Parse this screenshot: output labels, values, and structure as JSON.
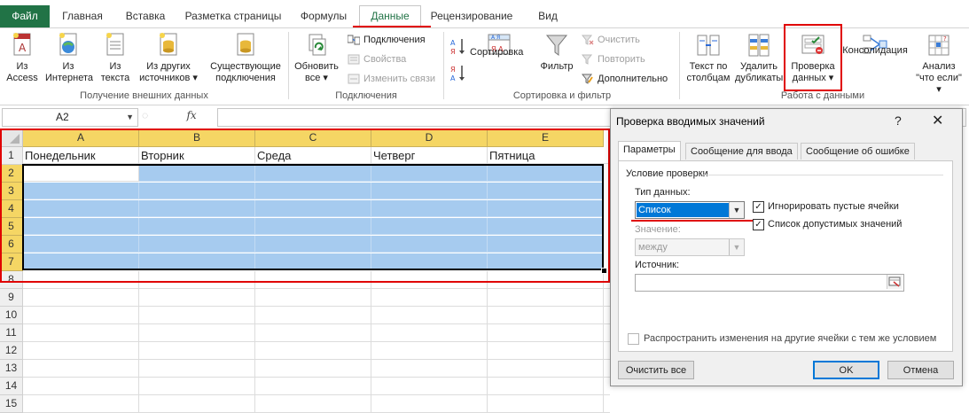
{
  "tabs": {
    "file": "Файл",
    "items": [
      "Главная",
      "Вставка",
      "Разметка страницы",
      "Формулы",
      "Данные",
      "Рецензирование",
      "Вид"
    ],
    "active": "Данные"
  },
  "ribbon": {
    "external": {
      "access": "Из Access",
      "web": "Из Интернета",
      "text": "Из текста",
      "other": "Из других источников ▾",
      "existing": "Существующие подключения",
      "label": "Получение внешних данных"
    },
    "connections": {
      "refresh": "Обновить все ▾",
      "connections": "Подключения",
      "properties": "Свойства",
      "edit_links": "Изменить связи",
      "label": "Подключения"
    },
    "sort_filter": {
      "sort": "Сортировка",
      "filter": "Фильтр",
      "clear": "Очистить",
      "reapply": "Повторить",
      "advanced": "Дополнительно",
      "label": "Сортировка и фильтр"
    },
    "data_tools": {
      "text_to_columns": "Текст по столбцам",
      "remove_duplicates": "Удалить дубликаты",
      "validation": "Проверка данных ▾",
      "consolidate": "Консолидация",
      "what_if": "Анализ \"что если\" ▾",
      "label": "Работа с данными"
    }
  },
  "formula_bar": {
    "name_box": "A2",
    "fx": "fx",
    "formula": ""
  },
  "sheet": {
    "columns": [
      "A",
      "B",
      "C",
      "D",
      "E"
    ],
    "rows": [
      "1",
      "2",
      "3",
      "4",
      "5",
      "6",
      "7",
      "8",
      "9",
      "10",
      "11",
      "12",
      "13",
      "14",
      "15"
    ],
    "row1": [
      "Понедельник",
      "Вторник",
      "Среда",
      "Четверг",
      "Пятница"
    ]
  },
  "dialog": {
    "title": "Проверка вводимых значений",
    "help": "?",
    "close": "✕",
    "tabs": [
      "Параметры",
      "Сообщение для ввода",
      "Сообщение об ошибке"
    ],
    "group_label": "Условие проверки",
    "type_label": "Тип данных:",
    "type_value": "Список",
    "ignore_blank": "Игнорировать пустые ячейки",
    "in_cell_dropdown": "Список допустимых значений",
    "value_label": "Значение:",
    "value_value": "между",
    "source_label": "Источник:",
    "source_value": "",
    "apply_all": "Распространить изменения на другие ячейки с тем же условием",
    "clear_all": "Очистить все",
    "ok": "OK",
    "cancel": "Отмена"
  },
  "colors": {
    "excel_green": "#217346",
    "highlight_red": "#e00000",
    "selection_blue": "#a6cbef",
    "header_selected": "#f5d664"
  }
}
